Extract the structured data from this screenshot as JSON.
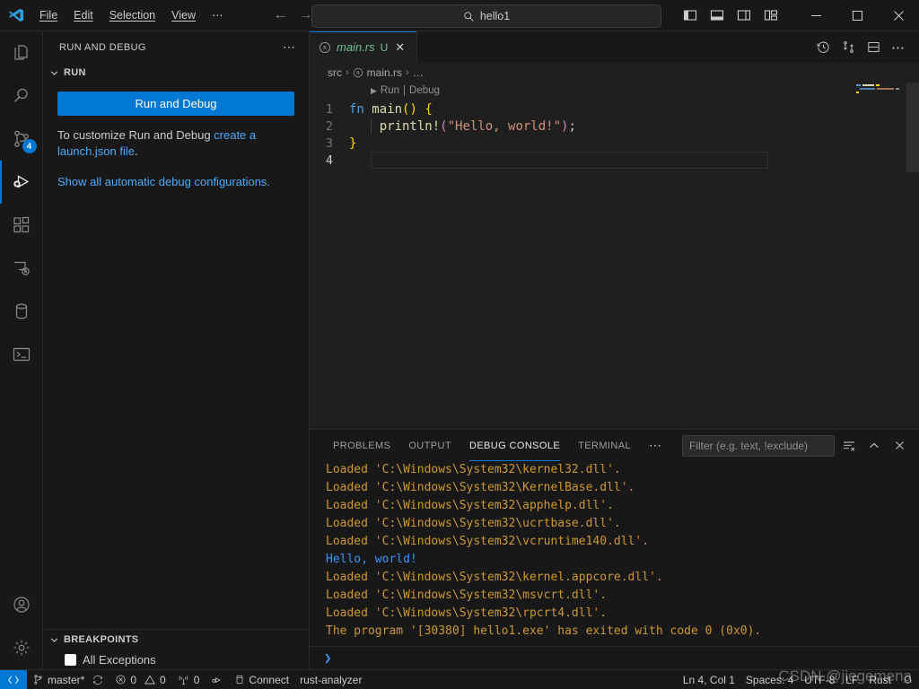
{
  "titlebar": {
    "logo": "vscode-logo",
    "menus": [
      "File",
      "Edit",
      "Selection",
      "View",
      "⋯"
    ],
    "nav_back": "←",
    "nav_forward": "→",
    "quickinput_value": "hello1",
    "layout_buttons": [
      "toggle-primary-sidebar",
      "toggle-panel",
      "toggle-secondary-sidebar",
      "customize-layout"
    ],
    "window_minimize": "─",
    "window_maximize": "☐",
    "window_close": "✕"
  },
  "activitybar": {
    "items": [
      {
        "name": "explorer",
        "label": "Explorer"
      },
      {
        "name": "search",
        "label": "Search"
      },
      {
        "name": "source-control",
        "label": "Source Control",
        "badge": "4"
      },
      {
        "name": "run-and-debug",
        "label": "Run and Debug",
        "active": true
      },
      {
        "name": "extensions",
        "label": "Extensions"
      },
      {
        "name": "remote-explorer",
        "label": "Remote Explorer"
      },
      {
        "name": "database",
        "label": "Database"
      },
      {
        "name": "terminal-activity",
        "label": "Terminal"
      }
    ],
    "bottom": [
      {
        "name": "accounts",
        "label": "Accounts"
      },
      {
        "name": "settings",
        "label": "Manage"
      }
    ]
  },
  "sidebar": {
    "title": "RUN AND DEBUG",
    "more_actions": "⋯",
    "run_section": {
      "label": "RUN",
      "expanded_icon": "chevron-down",
      "button_label": "Run and Debug",
      "hint_prefix": "To customize Run and Debug ",
      "hint_link": "create a launch.json file",
      "hint_suffix": ".",
      "automatic_link": "Show all automatic debug configurations."
    },
    "breakpoints_section": {
      "label": "BREAKPOINTS",
      "items": [
        {
          "label": "All Exceptions",
          "checked": true
        }
      ]
    }
  },
  "editor": {
    "tabs": [
      {
        "name": "main.rs",
        "icon": "rust-icon",
        "dirty_indicator": "U",
        "close": "✕",
        "active": true
      }
    ],
    "actions": [
      "timeline-icon",
      "compare-changes-icon",
      "split-editor-icon",
      "more-actions-icon"
    ],
    "breadcrumbs": [
      "src",
      "main.rs",
      "…"
    ],
    "codelens": {
      "run": "Run",
      "separator": "|",
      "debug": "Debug",
      "play_icon": "▶"
    },
    "lines": [
      {
        "num": "1",
        "tokens": [
          {
            "t": "fn",
            "c": "k-kw"
          },
          {
            "t": " ",
            "c": "k-punc"
          },
          {
            "t": "main",
            "c": "k-fn"
          },
          {
            "t": "()",
            "c": "k-paren"
          },
          {
            "t": " ",
            "c": "k-punc"
          },
          {
            "t": "{",
            "c": "k-brace"
          }
        ]
      },
      {
        "num": "2",
        "tokens": [
          {
            "t": "    ",
            "c": "k-punc"
          },
          {
            "t": "println!",
            "c": "k-fn"
          },
          {
            "t": "(",
            "c": "k-pink"
          },
          {
            "t": "\"Hello, world!\"",
            "c": "k-str"
          },
          {
            "t": ")",
            "c": "k-pink"
          },
          {
            "t": ";",
            "c": "k-punc"
          }
        ]
      },
      {
        "num": "3",
        "tokens": [
          {
            "t": "}",
            "c": "k-brace"
          }
        ]
      },
      {
        "num": "4",
        "tokens": []
      }
    ]
  },
  "panel": {
    "tabs": [
      "PROBLEMS",
      "OUTPUT",
      "DEBUG CONSOLE",
      "TERMINAL"
    ],
    "active_tab": "DEBUG CONSOLE",
    "more": "⋯",
    "filter_placeholder": "Filter (e.g. text, !exclude)",
    "actions": [
      "clear-console-icon",
      "collapse-panel-icon",
      "close-panel-icon"
    ],
    "console_lines": [
      {
        "text": "Loaded 'C:\\Windows\\System32\\kernel32.dll'.",
        "color": "c-yellow"
      },
      {
        "text": "Loaded 'C:\\Windows\\System32\\KernelBase.dll'.",
        "color": "c-yellow"
      },
      {
        "text": "Loaded 'C:\\Windows\\System32\\apphelp.dll'.",
        "color": "c-yellow"
      },
      {
        "text": "Loaded 'C:\\Windows\\System32\\ucrtbase.dll'.",
        "color": "c-yellow"
      },
      {
        "text": "Loaded 'C:\\Windows\\System32\\vcruntime140.dll'.",
        "color": "c-yellow"
      },
      {
        "text": "Hello, world!",
        "color": "c-blue"
      },
      {
        "text": "Loaded 'C:\\Windows\\System32\\kernel.appcore.dll'.",
        "color": "c-yellow"
      },
      {
        "text": "Loaded 'C:\\Windows\\System32\\msvcrt.dll'.",
        "color": "c-yellow"
      },
      {
        "text": "Loaded 'C:\\Windows\\System32\\rpcrt4.dll'.",
        "color": "c-yellow"
      },
      {
        "text": "The program '[30380] hello1.exe' has exited with code 0 (0x0).",
        "color": "c-yellow"
      }
    ],
    "repl_prompt": "❯"
  },
  "statusbar": {
    "remote_icon": "remote-window-icon",
    "branch": "master*",
    "sync_icon": "sync-icon",
    "errors": "0",
    "warnings": "0",
    "ports": "0",
    "debug_icon": "start-debug-icon",
    "db_connect": "Connect",
    "language_server": "rust-analyzer",
    "position": "Ln 4, Col 1",
    "indentation": "Spaces: 4",
    "encoding": "UTF-8",
    "eol": "LF",
    "language": "Rust",
    "bell_icon": "notifications-bell-icon"
  },
  "watermark": "CSDN @jiegemena",
  "colors": {
    "accent": "#0078d4",
    "background": "#1f1f1f",
    "chrome": "#181818",
    "link": "#4daafc",
    "console_yellow": "#cd9731",
    "console_blue": "#3794ff"
  }
}
